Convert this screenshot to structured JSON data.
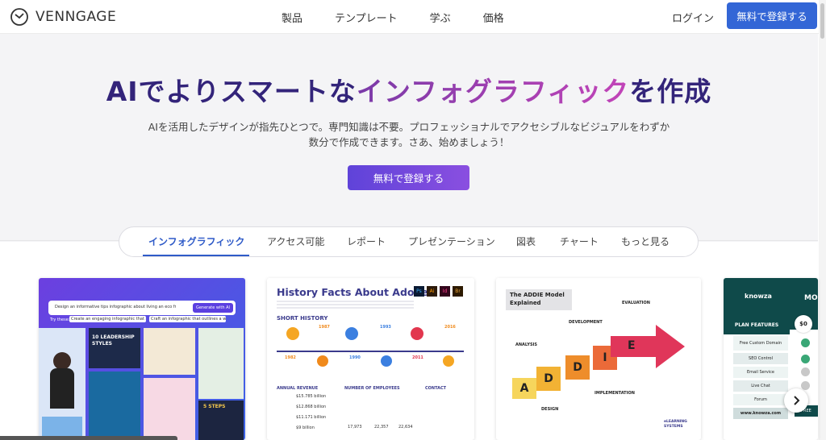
{
  "header": {
    "logo_text": "VENNGAGE",
    "nav": [
      "製品",
      "テンプレート",
      "学ぶ",
      "価格"
    ],
    "login": "ログイン",
    "signup": "無料で登録する"
  },
  "hero": {
    "title_part1": "AIでよりスマートな",
    "title_highlight": "インフォグラフィック",
    "title_part2": "を作成",
    "subtitle_line1": "AIを活用したデザインが指先ひとつで。専門知識は不要。プロフェッショナルでアクセシブルなビジュアルをわずか",
    "subtitle_line2": "数分で作成できます。さあ、始めましょう！",
    "cta": "無料で登録する"
  },
  "tabs": [
    "インフォグラフィック",
    "アクセス可能",
    "レポート",
    "プレゼンテーション",
    "図表",
    "チャート",
    "もっと見る"
  ],
  "cards": {
    "ai": {
      "prompt": "Design an informative tips infographic about living an eco friendly lifestyle",
      "button": "Generate with AI",
      "try_these": "Try these:",
      "suggestion1": "Create an engaging infographic that shows statistics...",
      "suggestion2": "Craft an infographic that outlines a weekly workout...",
      "thumb1": "10 LEADERSHIP STYLES",
      "thumb2": "5 STEPS"
    },
    "adobe": {
      "title": "History Facts About Adobe",
      "icons": [
        "Ps",
        "Ai",
        "Id",
        "Br"
      ],
      "short_history": "SHORT HISTORY",
      "years_top": [
        "1987",
        "1993",
        "2016"
      ],
      "years_bottom": [
        "1982",
        "1990",
        "2011"
      ],
      "annual_revenue": "ANNUAL REVENUE",
      "revenues": [
        "$15.785 billion",
        "$12.868 billion",
        "$11.171 billion",
        "$9 billion"
      ],
      "employees": "NUMBER OF EMPLOYEES",
      "employee_counts": [
        "17,973",
        "22,357",
        "22,634"
      ],
      "contact": "CONTACT"
    },
    "addie": {
      "title_line1": "The ADDIE Model",
      "title_line2": "Explained",
      "letters": [
        "A",
        "D",
        "D",
        "I",
        "E"
      ],
      "labels": [
        "ANALYSIS",
        "DESIGN",
        "DEVELOPMENT",
        "IMPLEMENTATION",
        "EVALUATION"
      ],
      "footer": "eLEARNING SYSTEMS"
    },
    "knowza": {
      "brand": "knowza",
      "heading": "PLAN FEATURES",
      "price": "$0",
      "mo": "MO",
      "free": "FREE",
      "features": [
        "Free Custom Domain",
        "SEO Control",
        "Email Service",
        "Live Chat",
        "Forum"
      ],
      "url": "www.knowza.com"
    }
  },
  "colors": {
    "primary": "#3366d6",
    "title_dark": "#33247a",
    "gradient_start": "#7a3aa8",
    "gradient_end": "#c244b8",
    "cta_start": "#5f43d9",
    "cta_end": "#8a4fe0"
  }
}
